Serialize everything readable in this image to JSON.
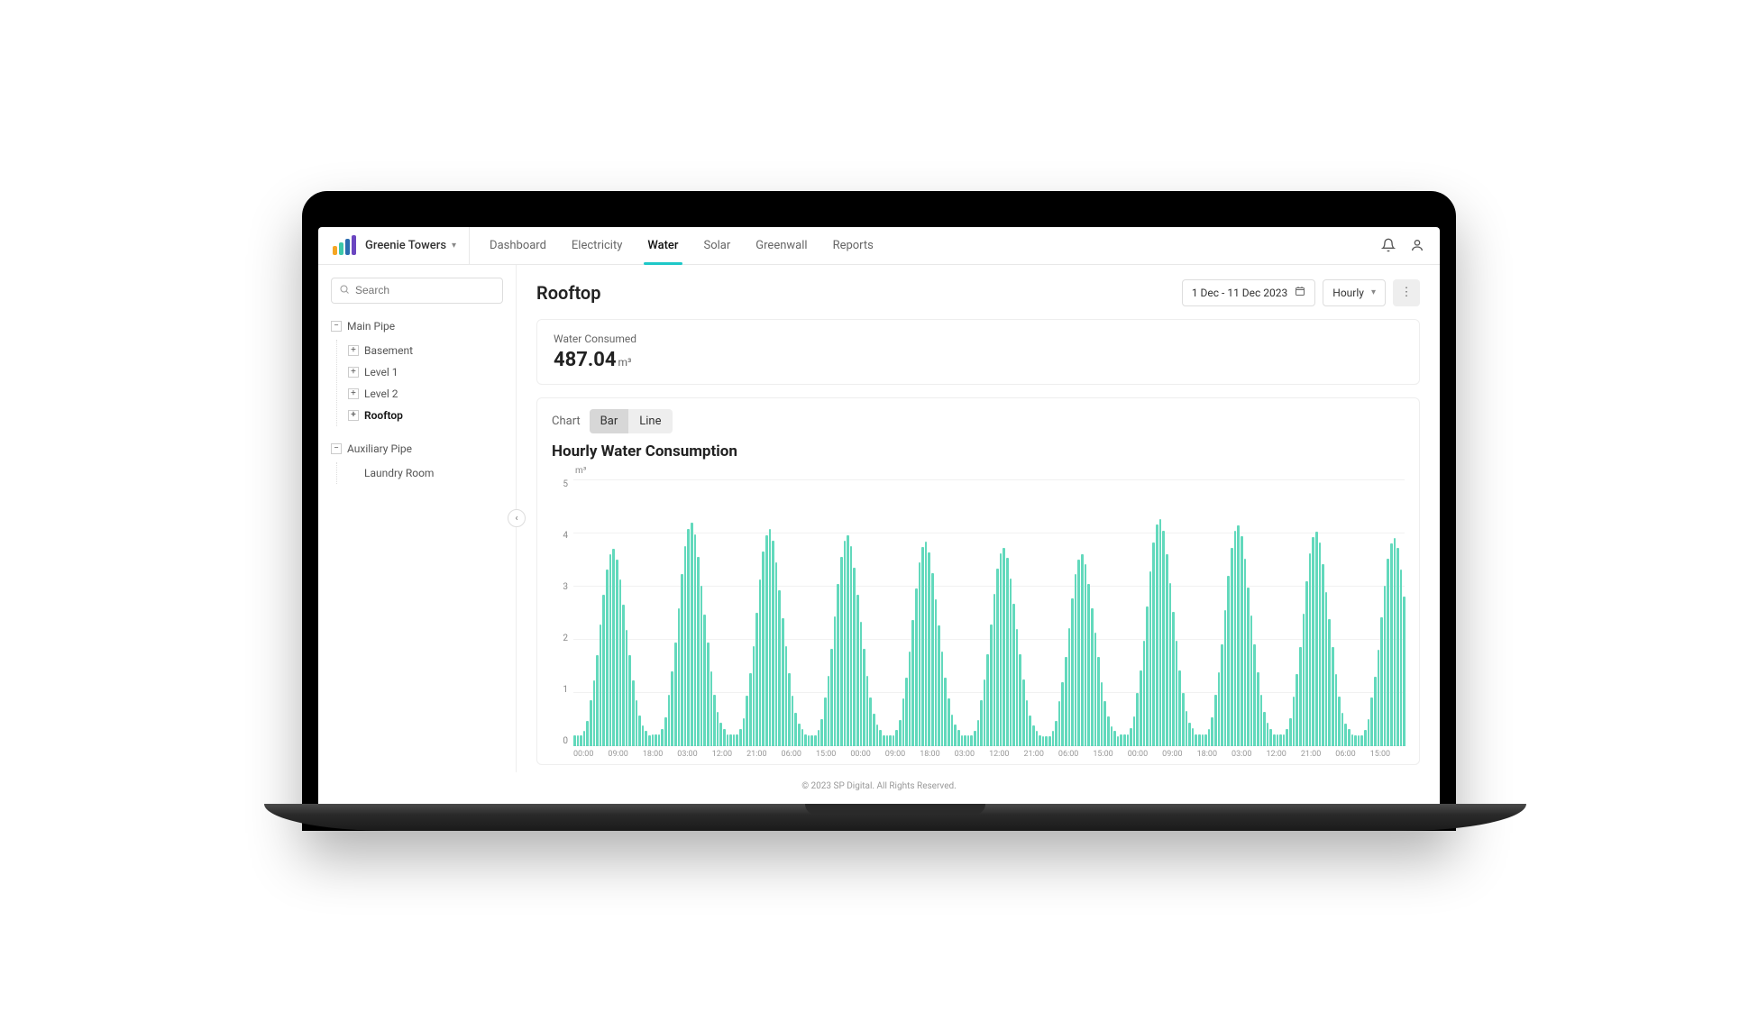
{
  "header": {
    "site_name": "Greenie Towers",
    "tabs": [
      "Dashboard",
      "Electricity",
      "Water",
      "Solar",
      "Greenwall",
      "Reports"
    ],
    "active_tab": "Water"
  },
  "sidebar": {
    "search_placeholder": "Search",
    "groups": [
      {
        "label": "Main Pipe",
        "expanded": true,
        "children": [
          {
            "label": "Basement",
            "expandable": true,
            "selected": false
          },
          {
            "label": "Level 1",
            "expandable": true,
            "selected": false
          },
          {
            "label": "Level 2",
            "expandable": true,
            "selected": false
          },
          {
            "label": "Rooftop",
            "expandable": true,
            "selected": true
          }
        ]
      },
      {
        "label": "Auxiliary Pipe",
        "expanded": true,
        "children": [
          {
            "label": "Laundry Room",
            "expandable": false,
            "selected": false
          }
        ]
      }
    ]
  },
  "main": {
    "title": "Rooftop",
    "date_range": "1 Dec - 11 Dec 2023",
    "granularity": "Hourly",
    "summary": {
      "label": "Water Consumed",
      "value": "487.04",
      "unit": "m³"
    },
    "chart_switch": {
      "label": "Chart",
      "options": [
        "Bar",
        "Line"
      ],
      "active": "Bar"
    },
    "chart_title": "Hourly Water Consumption"
  },
  "footer": "© 2023 SP Digital. All Rights Reserved.",
  "chart_data": {
    "type": "bar",
    "title": "Hourly Water Consumption",
    "ylabel": "m³",
    "ylim": [
      0,
      5
    ],
    "yticks": [
      0,
      1,
      2,
      3,
      4,
      5
    ],
    "xticks": [
      "00:00",
      "09:00",
      "18:00",
      "03:00",
      "12:00",
      "21:00",
      "06:00",
      "15:00",
      "00:00",
      "09:00",
      "18:00",
      "03:00",
      "12:00",
      "21:00",
      "06:00",
      "15:00",
      "00:00",
      "09:00",
      "18:00",
      "03:00",
      "12:00",
      "21:00",
      "06:00",
      "15:00"
    ],
    "categories_note": "hourly bars across 1 Dec 00:00 – 11 Dec 15:00 (approx. 255 bars)",
    "daily_pattern": {
      "comment": "24-hour values in m³ repeated each day; estimated from bar heights vs. y-axis",
      "values": [
        0.2,
        0.2,
        0.2,
        0.3,
        0.5,
        0.9,
        1.3,
        1.8,
        2.4,
        3.0,
        3.5,
        3.8,
        3.9,
        3.7,
        3.3,
        2.8,
        2.3,
        1.8,
        1.3,
        0.9,
        0.6,
        0.4,
        0.3,
        0.2
      ]
    },
    "days": 10.65,
    "peak_value": 4.1
  }
}
